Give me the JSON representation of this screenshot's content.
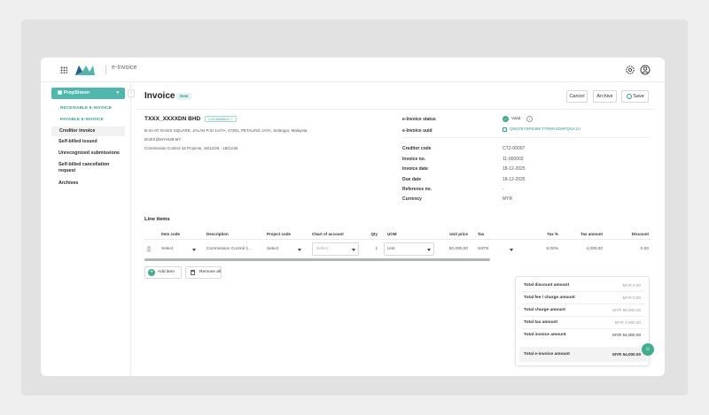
{
  "app": {
    "name": "e-Invoice"
  },
  "sidebar": {
    "org": "PropSimon",
    "links": [
      "RECEIVABLE E-INVOICE",
      "PAYABLE E-INVOICE"
    ],
    "items": [
      {
        "label": "Creditor invoice",
        "active": true
      },
      {
        "label": "Self-billed issued"
      },
      {
        "label": "Unrecognized submissions"
      },
      {
        "label": "Self-billed cancellation"
      },
      {
        "label": "request"
      },
      {
        "label": "Archives"
      }
    ]
  },
  "header": {
    "title": "Invoice",
    "badge": "New",
    "cancel": "Cancel",
    "archive": "Archive",
    "save": "Save"
  },
  "company": {
    "name": "TXXX_XXXXDN BHD",
    "tin": "C23735508010",
    "address": "B-3A-07 OASIS SQUARE, JALAN PJU 1A/7A, 47301, PETALING JAYA, Selangor, Malaysia",
    "email": "DUEX@MYHUB.MY",
    "description": "Commission Control 15 Projects, 18/12/25 - 18/11/26"
  },
  "details": {
    "status_label": "e-Invoice status",
    "status_value": "Valid",
    "uuid_label": "e-Invoice uuid",
    "uuid_value": "QMJ75Y5P636KT7RMV4D6PQCK10",
    "fields": [
      {
        "label": "Creditor code",
        "value": "CTZ-00007"
      },
      {
        "label": "Invoice no.",
        "value": "11-000003"
      },
      {
        "label": "Invoice date",
        "value": "18-12-2025"
      },
      {
        "label": "Due date",
        "value": "18-12-2025"
      },
      {
        "label": "Reference no.",
        "value": "-"
      },
      {
        "label": "Currency",
        "value": "MYR"
      }
    ]
  },
  "line_items": {
    "title": "Line items",
    "columns": [
      "Item code",
      "Description",
      "Project code",
      "Chart of account",
      "Qty",
      "UOM",
      "Unit price",
      "Tax",
      "Tax %",
      "Tax amount",
      "Discount"
    ],
    "row": {
      "item_code": "Select",
      "description": "Commission Control 1...",
      "project_code": "Select",
      "chart_of_account": "Select",
      "qty": "1",
      "uom": "Unit",
      "unit_price": "50,000.00",
      "tax": "SST8",
      "tax_pct": "8.00%",
      "tax_amount": "4,000.00",
      "discount": "0.00"
    },
    "add_item": "Add item",
    "remove_all": "Remove all"
  },
  "totals": [
    {
      "label": "Total discount amount",
      "value": "MYR 0.00"
    },
    {
      "label": "Total fee / charge amount",
      "value": "MYR 0.00"
    },
    {
      "label": "Total charge amount",
      "value": "MYR 50,000.00"
    },
    {
      "label": "Total tax amount",
      "value": "MYR 4,000.00"
    },
    {
      "label": "Total invoice amount",
      "value": "MYR 54,000.00"
    },
    {
      "label": "Total e-invoice amount",
      "value": "MYR 54,000.00"
    }
  ],
  "colors": {
    "accent": "#4fb8ad",
    "accent_dark": "#2e9e93",
    "success": "#3fae8f"
  }
}
